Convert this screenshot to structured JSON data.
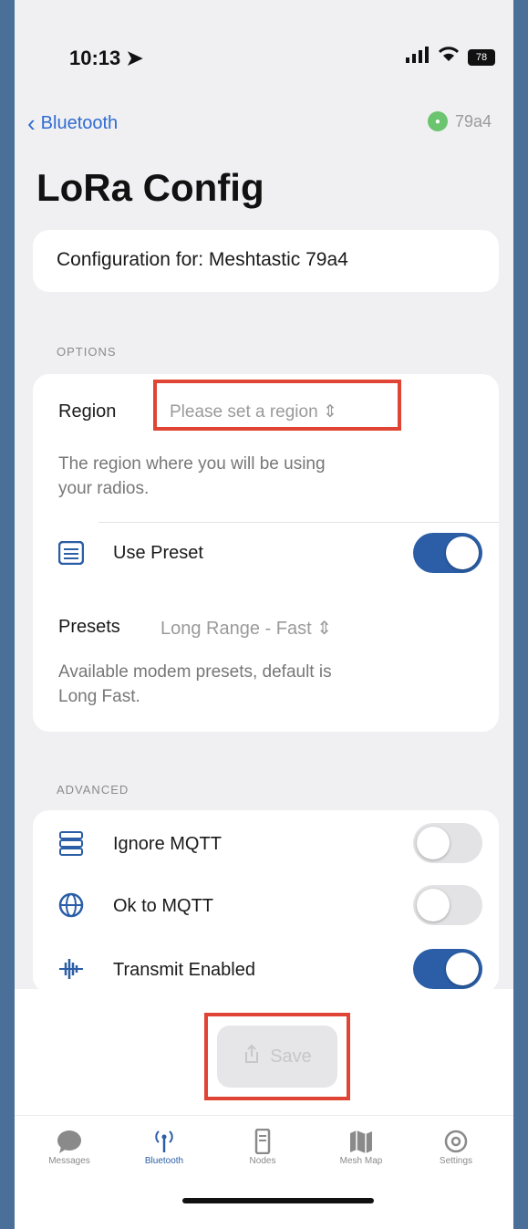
{
  "status": {
    "time": "10:13",
    "location_icon": "location-arrow-icon",
    "battery": "78"
  },
  "nav": {
    "back_label": "Bluetooth",
    "device_short": "79a4"
  },
  "page": {
    "title": "LoRa Config"
  },
  "config": {
    "label": "Configuration for: Meshtastic 79a4"
  },
  "options": {
    "header": "OPTIONS",
    "region_label": "Region",
    "region_value": "Please set a region ⇕",
    "region_desc_1": "The region where you will be using",
    "region_desc_2": "your radios.",
    "use_preset_label": "Use Preset",
    "use_preset_on": true,
    "presets_label": "Presets",
    "presets_value": "Long Range - Fast ⇕",
    "presets_desc_1": "Available modem presets, default is",
    "presets_desc_2": "Long Fast."
  },
  "advanced": {
    "header": "ADVANCED",
    "ignore_mqtt_label": "Ignore MQTT",
    "ok_mqtt_label": "Ok to MQTT",
    "transmit_label": "Transmit Enabled"
  },
  "save": {
    "label": "Save"
  },
  "tabs": [
    {
      "label": "Messages"
    },
    {
      "label": "Bluetooth"
    },
    {
      "label": "Nodes"
    },
    {
      "label": "Mesh Map"
    },
    {
      "label": "Settings"
    }
  ],
  "colors": {
    "accent": "#2b5ea6",
    "highlight": "#e04434"
  }
}
